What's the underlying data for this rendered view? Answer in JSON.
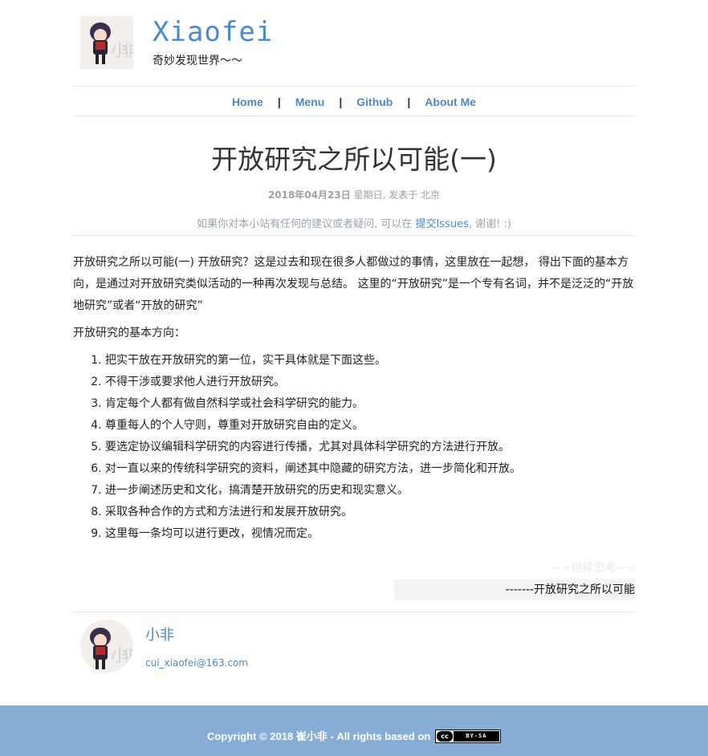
{
  "site": {
    "title": "Xiaofei",
    "subtitle": "奇妙发现世界～～",
    "avatar_icon": "anime-girl-avatar-icon"
  },
  "nav": {
    "items": [
      {
        "label": "Home"
      },
      {
        "label": "Menu"
      },
      {
        "label": "Github"
      },
      {
        "label": "About Me"
      }
    ],
    "separator": "|"
  },
  "post": {
    "title": "开放研究之所以可能(一)",
    "date": "2018年04月23日",
    "meta_rest": " 星期日, 发表于 北京",
    "notice_prefix": "如果你对本小站有任何的建议或者疑问, 可以在 ",
    "notice_link": "提交Issues",
    "notice_suffix": ", 谢谢! :)",
    "paragraph1": "开放研究之所以可能(一) 开放研究？这是过去和现在很多人都做过的事情，这里放在一起想， 得出下面的基本方向，是通过对开放研究类似活动的一种再次发现与总结。 这里的“开放研究”是一个专有名词，并不是泛泛的“开放地研究”或者“开放的研究”",
    "paragraph2": "开放研究的基本方向：",
    "list": [
      "把实干放在开放研究的第一位，实干具体就是下面这些。",
      "不得干涉或要求他人进行开放研究。",
      "肯定每个人都有做自然科学或社会科学研究的能力。",
      "尊重每人的个人守则，尊重对开放研究自由的定义。",
      "要选定协议编辑科学研究的内容进行传播，尤其对具体科学研究的方法进行开放。",
      "对一直以来的传统科学研究的资料，阐述其中隐藏的研究方法，进一步简化和开放。",
      "进一步阐述历史和文化，搞清楚开放研究的历史和现实意义。",
      "采取各种合作的方式和方法进行和发展开放研究。",
      "这里每一条均可以进行更改，视情况而定。"
    ],
    "signoff": "~~继续思考~~",
    "quote": "-------开放研究之所以可能"
  },
  "author": {
    "name": "小非",
    "email": "cui_xiaofei@163.com",
    "avatar_icon": "anime-girl-avatar-icon"
  },
  "footer": {
    "text": "Copyright © 2018 崔小非 - All rights based on ",
    "license_badge": "BY-SA",
    "license_icon": "cc",
    "background": "#86aed4"
  },
  "colors": {
    "accent": "#4a8ac9",
    "footer": "#86aed4"
  }
}
